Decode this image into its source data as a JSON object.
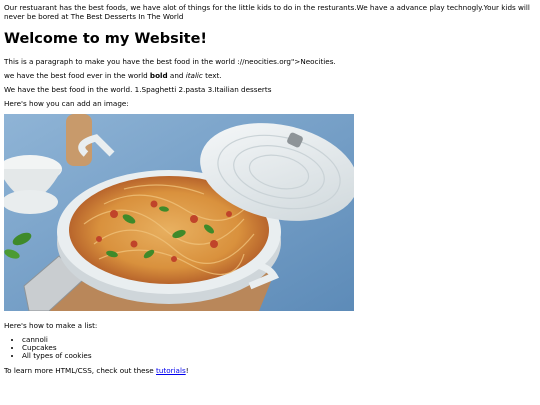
{
  "intro_text": "Our restuarant has the best foods, we have alot of things for the little kids to do in the resturants.We have a advance play technogly.Your kids will never be bored at The Best Desserts In The World",
  "heading": "Welcome to my Website!",
  "paragraph1": "This is a paragraph to make you have the best food in the world ://neocities.org\">Neocities.",
  "paragraph2": {
    "before": "we have the best food ever in the world ",
    "bold": "bold",
    "middle": " and ",
    "italic": "italic",
    "after": " text."
  },
  "paragraph3": "We have the best food in the world. 1.Spaghetti 2.pasta 3.Itailian desserts",
  "image_intro": "Here's how you can add an image:",
  "image": {
    "name": "pasta-pan-photo",
    "colors": {
      "background": "#7aa3c9",
      "board": "#b9875a",
      "pan": "#e9eef0",
      "pasta": "#e0a14d",
      "sauce": "#c0442a",
      "basil": "#3f8a2a"
    }
  },
  "list_intro": "Here's how to make a list:",
  "list_items": [
    "cannoli",
    "Cupcakes",
    "All types of cookies"
  ],
  "footer": {
    "before": "To learn more HTML/CSS, check out these ",
    "link": "tutorials",
    "after": "!"
  }
}
